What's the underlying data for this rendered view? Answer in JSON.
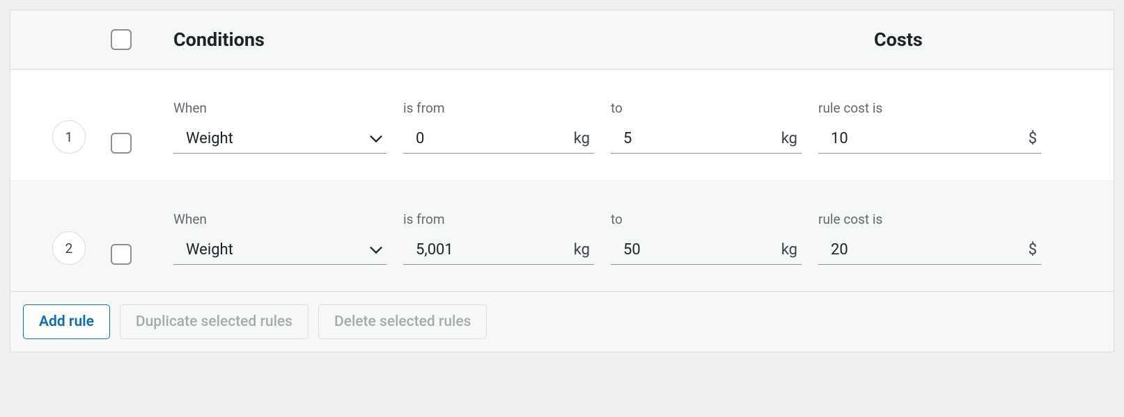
{
  "header": {
    "conditions_label": "Conditions",
    "costs_label": "Costs"
  },
  "field_labels": {
    "when": "When",
    "is_from": "is from",
    "to": "to",
    "rule_cost_is": "rule cost is"
  },
  "units": {
    "weight": "kg",
    "currency": "$"
  },
  "rows": [
    {
      "index": "1",
      "conditionType": "Weight",
      "from": "0",
      "to": "5",
      "cost": "10"
    },
    {
      "index": "2",
      "conditionType": "Weight",
      "from": "5,001",
      "to": "50",
      "cost": "20"
    }
  ],
  "footer": {
    "add_rule": "Add rule",
    "duplicate": "Duplicate selected rules",
    "delete": "Delete selected rules"
  }
}
